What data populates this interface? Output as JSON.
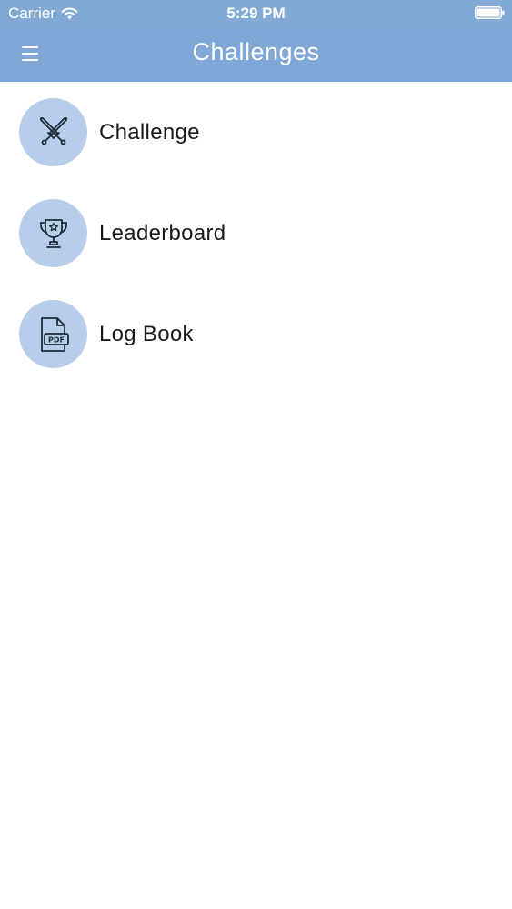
{
  "status_bar": {
    "carrier": "Carrier",
    "time": "5:29 PM",
    "wifi_icon": "wifi-icon",
    "battery_icon": "battery-icon"
  },
  "nav": {
    "title": "Challenges",
    "menu_icon": "hamburger-menu-icon"
  },
  "colors": {
    "header": "#7ea6d5",
    "icon_circle": "#b8cde9",
    "icon_stroke": "#1e2b3a",
    "text": "#1a1a1a"
  },
  "menu": {
    "items": [
      {
        "label": "Challenge",
        "icon": "crossed-swords-icon"
      },
      {
        "label": "Leaderboard",
        "icon": "trophy-icon"
      },
      {
        "label": "Log Book",
        "icon": "pdf-document-icon"
      }
    ]
  }
}
